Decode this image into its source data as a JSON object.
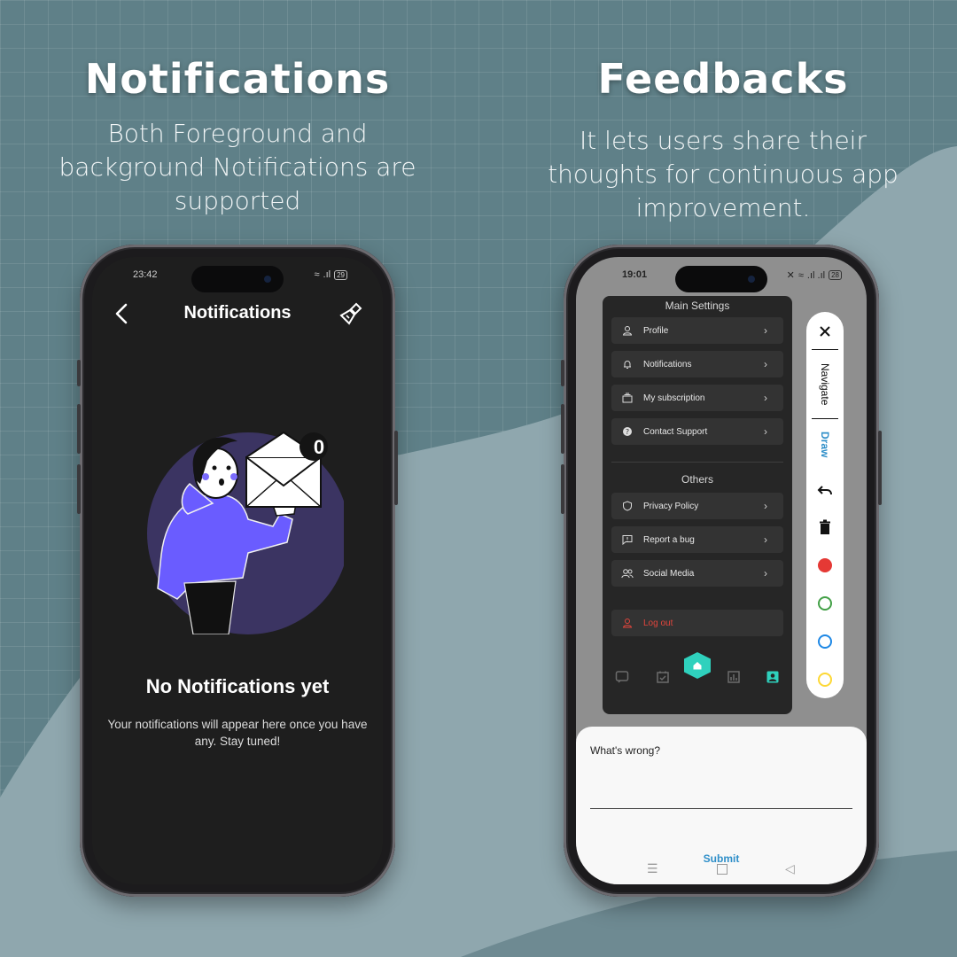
{
  "left_panel": {
    "title": "Notifications",
    "subtitle": "Both Foreground and background Notifications are supported"
  },
  "right_panel": {
    "title": "Feedbacks",
    "subtitle": "It lets users share their thoughts for continuous app improvement."
  },
  "left_phone": {
    "status_time": "23:42",
    "battery": "29",
    "header_title": "Notifications",
    "badge_count": "0",
    "empty_title": "No Notifications yet",
    "empty_desc": "Your notifications will appear here once you have any. Stay tuned!"
  },
  "right_phone": {
    "status_time": "19:01",
    "battery": "28",
    "settings": {
      "main_heading": "Main Settings",
      "main_items": [
        {
          "label": "Profile",
          "icon": "person-icon"
        },
        {
          "label": "Notifications",
          "icon": "bell-icon"
        },
        {
          "label": "My subscription",
          "icon": "subscription-icon"
        },
        {
          "label": "Contact Support",
          "icon": "help-icon"
        }
      ],
      "others_heading": "Others",
      "other_items": [
        {
          "label": "Privacy Policy",
          "icon": "shield-icon"
        },
        {
          "label": "Report a bug",
          "icon": "report-icon"
        },
        {
          "label": "Social Media",
          "icon": "people-icon"
        }
      ],
      "logout_label": "Log out"
    },
    "toolbar": {
      "navigate_label": "Navigate",
      "draw_label": "Draw",
      "colors": [
        "#e53935",
        "#43a047",
        "#1e88e5",
        "#fdd835"
      ]
    },
    "feedback": {
      "label": "What's wrong?",
      "submit_label": "Submit"
    }
  },
  "colors": {
    "background": "#5f8088",
    "accent_teal": "#2fd1bd",
    "illustration_purple": "#6a5cff",
    "logout_red": "#e2453c",
    "submit_blue": "#2f8fc9"
  }
}
